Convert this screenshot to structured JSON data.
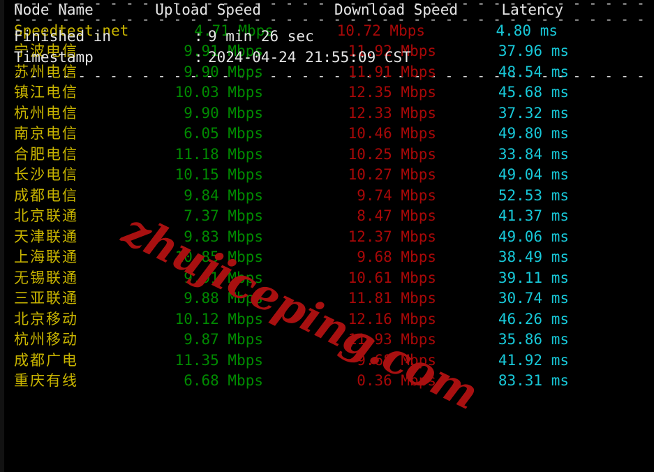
{
  "terminal": {
    "separator_char": "- - - - - - - - - - - - - - - - - - - - - - - - - - - - - - - - - - - - - - - - - - - - - - - - - - - - -",
    "colors": {
      "background": "#000000",
      "node_name": "#c8b400",
      "upload": "#008a00",
      "download": "#a80808",
      "latency": "#18c8d8",
      "header": "#e6e6e6",
      "separator": "#d8d8d8",
      "watermark": "#a81010"
    }
  },
  "watermark": {
    "text": "zhujiceping.com"
  },
  "table": {
    "headers": {
      "node_name": "Node Name",
      "upload_speed": "Upload Speed",
      "download_speed": "Download Speed",
      "latency": "Latency"
    },
    "rows": [
      {
        "name": "Speedtest.net",
        "latin": true,
        "upload": "4.71 Mbps",
        "download": "10.72 Mbps",
        "latency": "4.80 ms"
      },
      {
        "name": "宁波电信",
        "latin": false,
        "upload": "9.91 Mbps",
        "download": "11.92 Mbps",
        "latency": "37.96 ms"
      },
      {
        "name": "苏州电信",
        "latin": false,
        "upload": "9.90 Mbps",
        "download": "11.91 Mbps",
        "latency": "48.54 ms"
      },
      {
        "name": "镇江电信",
        "latin": false,
        "upload": "10.03 Mbps",
        "download": "12.35 Mbps",
        "latency": "45.68 ms"
      },
      {
        "name": "杭州电信",
        "latin": false,
        "upload": "9.90 Mbps",
        "download": "12.33 Mbps",
        "latency": "37.32 ms"
      },
      {
        "name": "南京电信",
        "latin": false,
        "upload": "6.05 Mbps",
        "download": "10.46 Mbps",
        "latency": "49.80 ms"
      },
      {
        "name": "合肥电信",
        "latin": false,
        "upload": "11.18 Mbps",
        "download": "10.25 Mbps",
        "latency": "33.84 ms"
      },
      {
        "name": "长沙电信",
        "latin": false,
        "upload": "10.15 Mbps",
        "download": "10.27 Mbps",
        "latency": "49.04 ms"
      },
      {
        "name": "成都电信",
        "latin": false,
        "upload": "9.84 Mbps",
        "download": "9.74 Mbps",
        "latency": "52.53 ms"
      },
      {
        "name": "北京联通",
        "latin": false,
        "upload": "7.37 Mbps",
        "download": "8.47 Mbps",
        "latency": "41.37 ms"
      },
      {
        "name": "天津联通",
        "latin": false,
        "upload": "9.83 Mbps",
        "download": "12.37 Mbps",
        "latency": "49.06 ms"
      },
      {
        "name": "上海联通",
        "latin": false,
        "upload": "10.85 Mbps",
        "download": "9.68 Mbps",
        "latency": "38.49 ms"
      },
      {
        "name": "无锡联通",
        "latin": false,
        "upload": "9.91 Mbps",
        "download": "10.61 Mbps",
        "latency": "39.11 ms"
      },
      {
        "name": "三亚联通",
        "latin": false,
        "upload": "9.88 Mbps",
        "download": "11.81 Mbps",
        "latency": "30.74 ms"
      },
      {
        "name": "北京移动",
        "latin": false,
        "upload": "10.12 Mbps",
        "download": "12.16 Mbps",
        "latency": "46.26 ms"
      },
      {
        "name": "杭州移动",
        "latin": false,
        "upload": "9.87 Mbps",
        "download": "11.93 Mbps",
        "latency": "35.86 ms"
      },
      {
        "name": "成都广电",
        "latin": false,
        "upload": "11.35 Mbps",
        "download": "9.68 Mbps",
        "latency": "41.92 ms"
      },
      {
        "name": "重庆有线",
        "latin": false,
        "upload": "6.68 Mbps",
        "download": "0.36 Mbps",
        "latency": "83.31 ms"
      }
    ]
  },
  "footer": {
    "lines": [
      {
        "label": "Finished in",
        "colon": ":",
        "value": "9 min 26 sec"
      },
      {
        "label": "Timestamp",
        "colon": ":",
        "value": "2024-04-24 21:55:09 CST"
      }
    ]
  }
}
